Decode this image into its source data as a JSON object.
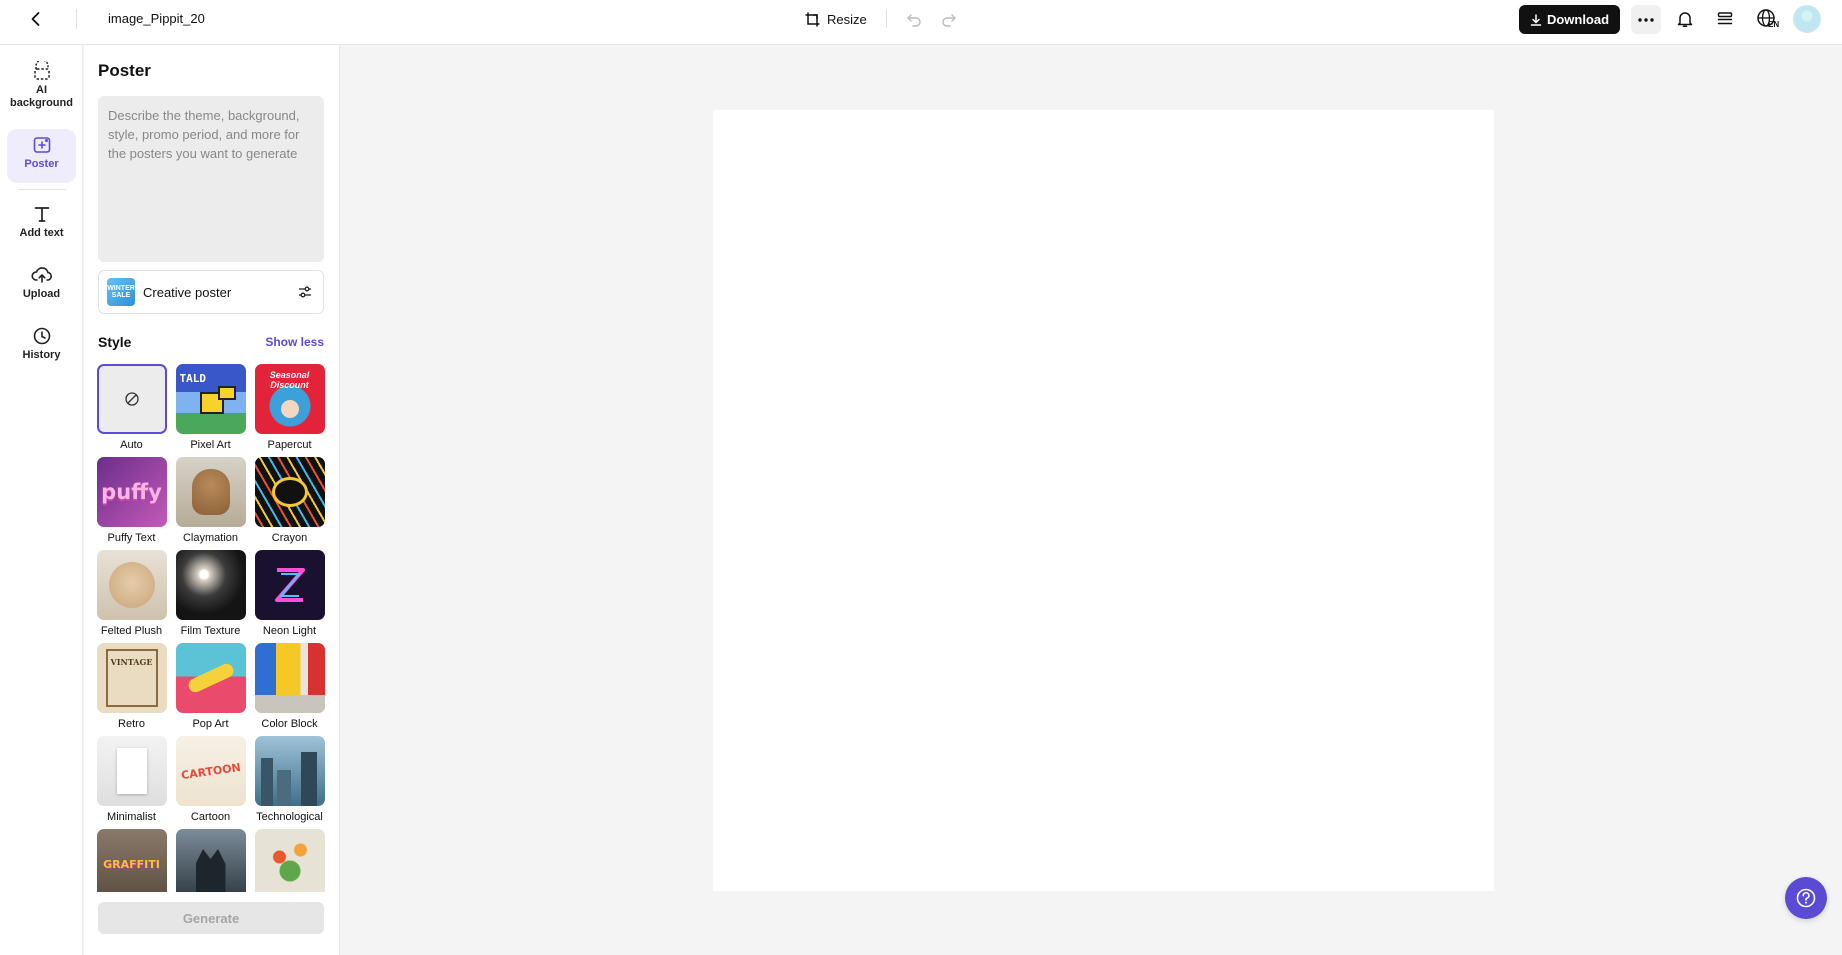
{
  "topbar": {
    "file_name": "image_Pippit_20",
    "resize_label": "Resize",
    "download_label": "Download",
    "language_code": "EN"
  },
  "rail": {
    "items": [
      {
        "label": "AI background",
        "icon": "ai-background-icon"
      },
      {
        "label": "Poster",
        "icon": "poster-icon",
        "active": true
      },
      {
        "label": "Add text",
        "icon": "text-icon"
      },
      {
        "label": "Upload",
        "icon": "upload-cloud-icon"
      },
      {
        "label": "History",
        "icon": "clock-icon"
      }
    ]
  },
  "panel": {
    "title": "Poster",
    "prompt_placeholder": "Describe the theme, background, style, promo period, and more for the posters you want to generate",
    "prompt_value": "",
    "creative": {
      "label": "Creative poster",
      "thumb_text": "WINTER SALE"
    },
    "style_label": "Style",
    "show_less": "Show less",
    "generate_label": "Generate",
    "styles": [
      {
        "name": "Auto",
        "selected": true
      },
      {
        "name": "Pixel Art",
        "thumb_text": "TALD"
      },
      {
        "name": "Papercut",
        "thumb_text": "Seasonal Discount"
      },
      {
        "name": "Puffy Text",
        "thumb_text": "puffy"
      },
      {
        "name": "Claymation"
      },
      {
        "name": "Crayon"
      },
      {
        "name": "Felted Plush"
      },
      {
        "name": "Film Texture"
      },
      {
        "name": "Neon Light"
      },
      {
        "name": "Retro",
        "thumb_text": "VINTAGE"
      },
      {
        "name": "Pop Art"
      },
      {
        "name": "Color Block"
      },
      {
        "name": "Minimalist"
      },
      {
        "name": "Cartoon",
        "thumb_text": "CARTOON"
      },
      {
        "name": "Technological"
      },
      {
        "name": "",
        "thumb_text": "GRAFFITI"
      },
      {
        "name": ""
      },
      {
        "name": ""
      }
    ]
  },
  "colors": {
    "accent": "#5b4bd6",
    "download_bg": "#111111",
    "help_bg": "#5a4ad4"
  }
}
